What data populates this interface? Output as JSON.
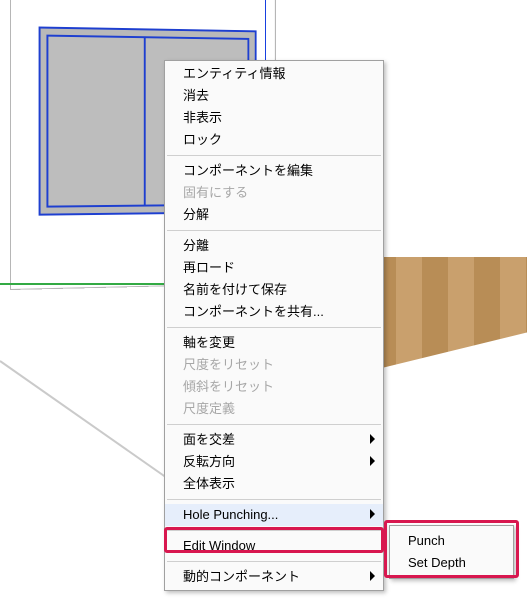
{
  "scene": {
    "selected_component": "window"
  },
  "menu": {
    "items": [
      {
        "label": "エンティティ情報",
        "enabled": true,
        "sub": false
      },
      {
        "label": "消去",
        "enabled": true,
        "sub": false
      },
      {
        "label": "非表示",
        "enabled": true,
        "sub": false
      },
      {
        "label": "ロック",
        "enabled": true,
        "sub": false
      },
      {
        "sep": true
      },
      {
        "label": "コンポーネントを編集",
        "enabled": true,
        "sub": false
      },
      {
        "label": "固有にする",
        "enabled": false,
        "sub": false
      },
      {
        "label": "分解",
        "enabled": true,
        "sub": false
      },
      {
        "sep": true
      },
      {
        "label": "分離",
        "enabled": true,
        "sub": false
      },
      {
        "label": "再ロード",
        "enabled": true,
        "sub": false
      },
      {
        "label": "名前を付けて保存",
        "enabled": true,
        "sub": false
      },
      {
        "label": "コンポーネントを共有...",
        "enabled": true,
        "sub": false
      },
      {
        "sep": true
      },
      {
        "label": "軸を変更",
        "enabled": true,
        "sub": false
      },
      {
        "label": "尺度をリセット",
        "enabled": false,
        "sub": false
      },
      {
        "label": "傾斜をリセット",
        "enabled": false,
        "sub": false
      },
      {
        "label": "尺度定義",
        "enabled": false,
        "sub": false
      },
      {
        "sep": true
      },
      {
        "label": "面を交差",
        "enabled": true,
        "sub": true
      },
      {
        "label": "反転方向",
        "enabled": true,
        "sub": true
      },
      {
        "label": "全体表示",
        "enabled": true,
        "sub": false
      },
      {
        "sep": true
      },
      {
        "label": "Hole Punching...",
        "enabled": true,
        "sub": true,
        "highlighted": true
      },
      {
        "sep": true
      },
      {
        "label": "Edit Window",
        "enabled": true,
        "sub": false
      },
      {
        "sep": true
      },
      {
        "label": "動的コンポーネント",
        "enabled": true,
        "sub": true
      }
    ]
  },
  "submenu": {
    "parent": "Hole Punching...",
    "items": [
      {
        "label": "Punch"
      },
      {
        "label": "Set Depth"
      }
    ]
  },
  "highlight_color": "#d8174f"
}
